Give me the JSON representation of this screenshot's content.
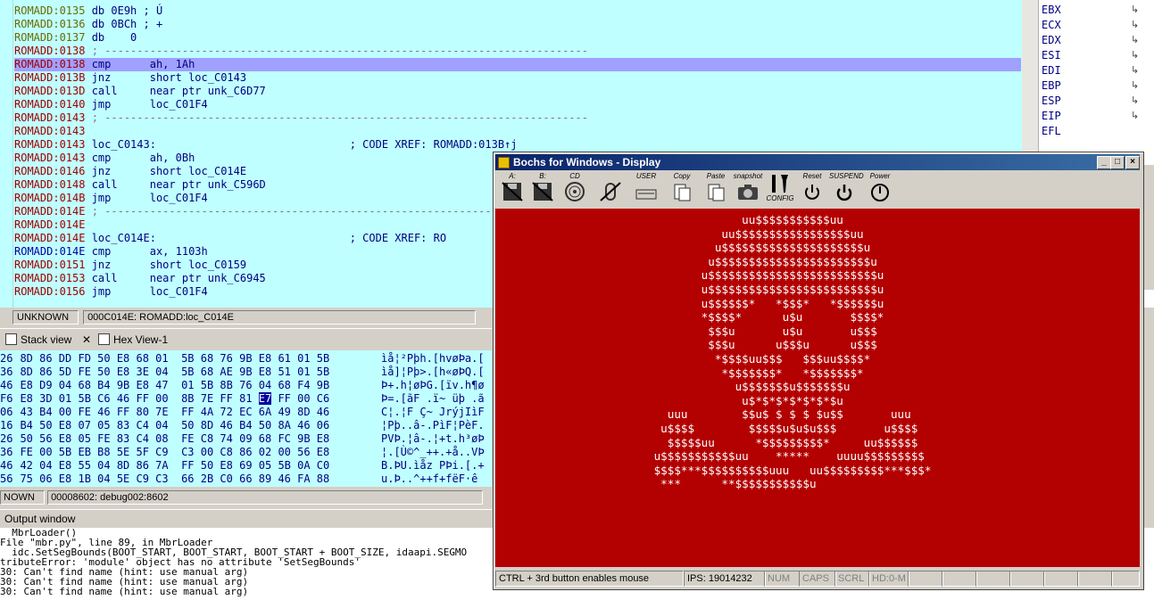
{
  "disasm": {
    "lines": [
      {
        "addr": "ROMADD:0135",
        "text": " db 0E9h ; Ú",
        "cls": "seg-g"
      },
      {
        "addr": "ROMADD:0136",
        "text": " db 0BCh ; +",
        "cls": "seg-g"
      },
      {
        "addr": "ROMADD:0137",
        "text": " db    0",
        "cls": "seg-g"
      },
      {
        "addr": "ROMADD:0138",
        "text": " ; ---------------------------------------------------------------------------",
        "cls": "seg-r"
      },
      {
        "addr": "ROMADD:0138",
        "text": " cmp      ah, 1Ah",
        "cls": "seg-r",
        "hl": true
      },
      {
        "addr": "ROMADD:013B",
        "text": " jnz      short loc_C0143",
        "cls": "seg-r"
      },
      {
        "addr": "ROMADD:013D",
        "text": " call     near ptr unk_C6D77",
        "cls": "seg-r"
      },
      {
        "addr": "ROMADD:0140",
        "text": " jmp      loc_C01F4",
        "cls": "seg-r"
      },
      {
        "addr": "ROMADD:0143",
        "text": " ; ---------------------------------------------------------------------------",
        "cls": "seg-r"
      },
      {
        "addr": "ROMADD:0143",
        "text": "",
        "cls": "seg-r"
      },
      {
        "addr": "ROMADD:0143",
        "text": " loc_C0143:                              ; CODE XREF: ROMADD:013B↑j",
        "cls": "seg-r"
      },
      {
        "addr": "ROMADD:0143",
        "text": " cmp      ah, 0Bh",
        "cls": "seg-r"
      },
      {
        "addr": "ROMADD:0146",
        "text": " jnz      short loc_C014E",
        "cls": "seg-r"
      },
      {
        "addr": "ROMADD:0148",
        "text": " call     near ptr unk_C596D",
        "cls": "seg-r"
      },
      {
        "addr": "ROMADD:014B",
        "text": " jmp      loc_C01F4",
        "cls": "seg-r"
      },
      {
        "addr": "ROMADD:014E",
        "text": " ; ---------------------------------------------------------------------------",
        "cls": "seg-r"
      },
      {
        "addr": "ROMADD:014E",
        "text": "",
        "cls": "seg-r"
      },
      {
        "addr": "ROMADD:014E",
        "text": " loc_C014E:                              ; CODE XREF: RO",
        "cls": "seg-r"
      },
      {
        "addr": "ROMADD:014E",
        "text": " cmp      ax, 1103h",
        "cls": "seg-b"
      },
      {
        "addr": "ROMADD:0151",
        "text": " jnz      short loc_C0159",
        "cls": "seg-r"
      },
      {
        "addr": "ROMADD:0153",
        "text": " call     near ptr unk_C6945",
        "cls": "seg-r"
      },
      {
        "addr": "ROMADD:0156",
        "text": " jmp      loc_C01F4",
        "cls": "seg-r"
      }
    ],
    "status_left": "UNKNOWN",
    "status_right": "000C014E: ROMADD:loc_C014E"
  },
  "registers": [
    "EBX",
    "ECX",
    "EDX",
    "ESI",
    "EDI",
    "EBP",
    "ESP",
    "EIP",
    "EFL"
  ],
  "tabs": {
    "stack": "Stack view",
    "hex": "Hex View-1"
  },
  "hex": {
    "rows": [
      {
        "pre": "26",
        "bytes": "8D 86 DD FD 50 E8 68 01  5B 68 76 9B E8 61 01 5B",
        "ascii": "ìå¦²Pþh.[hvøÞa.["
      },
      {
        "pre": "36",
        "bytes": "8D 86 5D FE 50 E8 3E 04  5B 68 AE 9B E8 51 01 5B",
        "ascii": "ìå]¦Pþ>.[h«øÞQ.["
      },
      {
        "pre": "46",
        "bytes": "E8 D9 04 68 B4 9B E8 47  01 5B 8B 76 04 68 F4 9B",
        "ascii": "Þ+.h¦øÞG.[ïv.h¶ø"
      },
      {
        "pre": "F6",
        "bytes": "E8 3D 01 5B C6 46 FF 00  8B 7E FF 81 E7 FF 00 C6",
        "ascii": "Þ=.[ãF .ï~ üþ .ã"
      },
      {
        "pre": "06",
        "bytes": "43 B4 00 FE 46 FF 80 7E  FF 4A 72 EC 6A 49 8D 46",
        "ascii": "C¦.¦F Ç~ JrýjIìF"
      },
      {
        "pre": "16",
        "bytes": "B4 50 E8 07 05 83 C4 04  50 8D 46 B4 50 8A 46 06",
        "ascii": "¦Pþ..â-.PìF¦PèF."
      },
      {
        "pre": "26",
        "bytes": "50 56 E8 05 FE 83 C4 08  FE C8 74 09 68 FC 9B E8",
        "ascii": "PVÞ.¦â-.¦+t.h³øÞ"
      },
      {
        "pre": "36",
        "bytes": "FE 00 5B EB B8 5E 5F C9  C3 00 C8 86 02 00 56 E8",
        "ascii": "¦.[Ù©^_++.+å..VÞ"
      },
      {
        "pre": "46",
        "bytes": "42 04 E8 55 04 8D 86 7A  FF 50 E8 69 05 5B 0A C0",
        "ascii": "B.ÞU.ìåz PÞi.[.+"
      },
      {
        "pre": "56",
        "bytes": "75 06 E8 1B 04 5E C9 C3  66 2B C0 66 89 46 FA 88",
        "ascii": "u.Þ..^++f+fëF·ê"
      }
    ],
    "status_left": "NOWN",
    "status_right": "00008602: debug002:8602"
  },
  "output": {
    "title": "Output window",
    "lines": [
      "  MbrLoader()",
      "File \"mbr.py\", line 89, in MbrLoader",
      "  idc.SetSegBounds(BOOT_START, BOOT_START, BOOT_START + BOOT_SIZE, idaapi.SEGMO",
      "tributeError: 'module' object has no attribute 'SetSegBounds'",
      "30: Can't find name (hint: use manual arg)",
      "30: Can't find name (hint: use manual arg)",
      "30: Can't find name (hint: use manual arg)"
    ]
  },
  "bochs": {
    "title": "Bochs for Windows - Display",
    "toolbar": [
      {
        "label": "A:",
        "icon": "floppy-a-icon"
      },
      {
        "label": "B:",
        "icon": "floppy-b-icon"
      },
      {
        "label": "CD",
        "icon": "cdrom-icon"
      },
      {
        "label": "",
        "icon": "mouse-icon"
      },
      {
        "label": "USER",
        "icon": "keyboard-icon"
      },
      {
        "label": "Copy",
        "icon": "copy-icon"
      },
      {
        "label": "Paste",
        "icon": "paste-icon"
      },
      {
        "label": "snapshot",
        "icon": "camera-icon"
      },
      {
        "label": "CONFIG",
        "icon": "config-icon"
      },
      {
        "label": "Reset",
        "icon": "reset-icon"
      },
      {
        "label": "SUSPEND",
        "icon": "suspend-icon"
      },
      {
        "label": "Power",
        "icon": "power-icon"
      }
    ],
    "skull": "              uu$$$$$$$$$$$uu\n           uu$$$$$$$$$$$$$$$$$uu\n          u$$$$$$$$$$$$$$$$$$$$$u\n         u$$$$$$$$$$$$$$$$$$$$$$$u\n        u$$$$$$$$$$$$$$$$$$$$$$$$$u\n        u$$$$$$$$$$$$$$$$$$$$$$$$$u\n        u$$$$$$*   *$$$*   *$$$$$$u\n        *$$$$*      u$u       $$$$*\n         $$$u       u$u       u$$$\n         $$$u      u$$$u      u$$$\n          *$$$$uu$$$   $$$uu$$$$*\n           *$$$$$$$*   *$$$$$$$*\n             u$$$$$$$u$$$$$$$u\n              u$*$*$*$*$*$*$u\n   uuu        $$u$ $ $ $ $u$$       uuu\n  u$$$$        $$$$$u$u$u$$$       u$$$$\n   $$$$$uu      *$$$$$$$$$*     uu$$$$$$\n u$$$$$$$$$$$uu    *****    uuuu$$$$$$$$$\n $$$$***$$$$$$$$$$uuu   uu$$$$$$$$$***$$$*\n  ***      **$$$$$$$$$$$u",
    "status": {
      "hint": "CTRL + 3rd button enables mouse",
      "ips": "IPS:  19014232",
      "num": "NUM",
      "caps": "CAPS",
      "scrl": "SCRL",
      "hd": "HD:0-M"
    }
  }
}
